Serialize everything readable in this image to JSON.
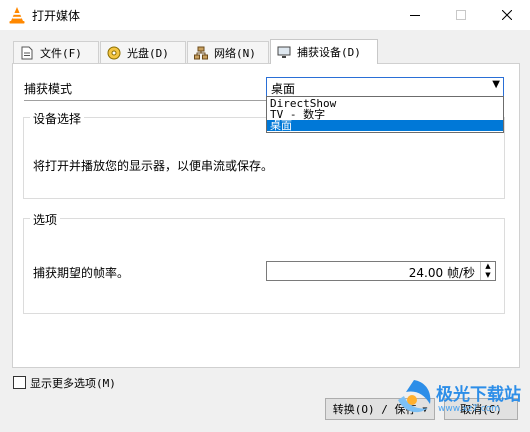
{
  "window": {
    "title": "打开媒体",
    "icon": "vlc-cone-icon"
  },
  "tabs": [
    {
      "label": "文件(F)",
      "icon": "file-icon"
    },
    {
      "label": "光盘(D)",
      "icon": "disc-icon"
    },
    {
      "label": "网络(N)",
      "icon": "network-icon"
    },
    {
      "label": "捕获设备(D)",
      "icon": "capture-device-icon",
      "active": true
    }
  ],
  "capture": {
    "mode_label": "捕获模式",
    "mode_value": "桌面",
    "dropdown_options": [
      "DirectShow",
      "TV - 数字",
      "桌面"
    ],
    "selected_option": "桌面"
  },
  "device_group": {
    "title": "设备选择",
    "description": "将打开并播放您的显示器，以便串流或保存。"
  },
  "options_group": {
    "title": "选项",
    "frame_rate_label": "捕获期望的帧率。",
    "frame_rate_value": "24.00 帧/秒"
  },
  "footer": {
    "more_options_label": "显示更多选项(M)",
    "convert_save_label": "转换(O) / 保存",
    "cancel_label": "取消(C)"
  },
  "watermark": {
    "text": "极光下载站",
    "sub": "www.xz7.com"
  },
  "colors": {
    "selection": "#0078d7",
    "combo_border": "#2a6fd6",
    "vlc_orange": "#ff8800",
    "watermark_blue": "#2d8ee8"
  }
}
